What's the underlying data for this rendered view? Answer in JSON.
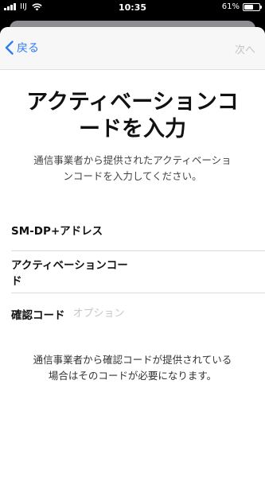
{
  "status_bar": {
    "carrier": "IIJ",
    "time": "10:35",
    "battery_percent": "61%",
    "battery_level": 0.61
  },
  "nav": {
    "back_label": "戻る",
    "next_label": "次へ"
  },
  "main": {
    "title_line1": "アクティベーションコ",
    "title_line2": "ードを入力",
    "subtitle_line1": "通信事業者から提供されたアクティベーショ",
    "subtitle_line2": "ンコードを入力してください。"
  },
  "form": {
    "fields": [
      {
        "label": "SM-DP+アドレス",
        "placeholder": ""
      },
      {
        "label": "アクティベーションコード",
        "placeholder": ""
      },
      {
        "label": "確認コード",
        "placeholder": "オプション"
      }
    ]
  },
  "footnote": {
    "line1": "通信事業者から確認コードが提供されている",
    "line2": "場合はそのコードが必要になります。"
  },
  "colors": {
    "accent": "#2f7cf6",
    "disabled": "#c3c3c8"
  }
}
